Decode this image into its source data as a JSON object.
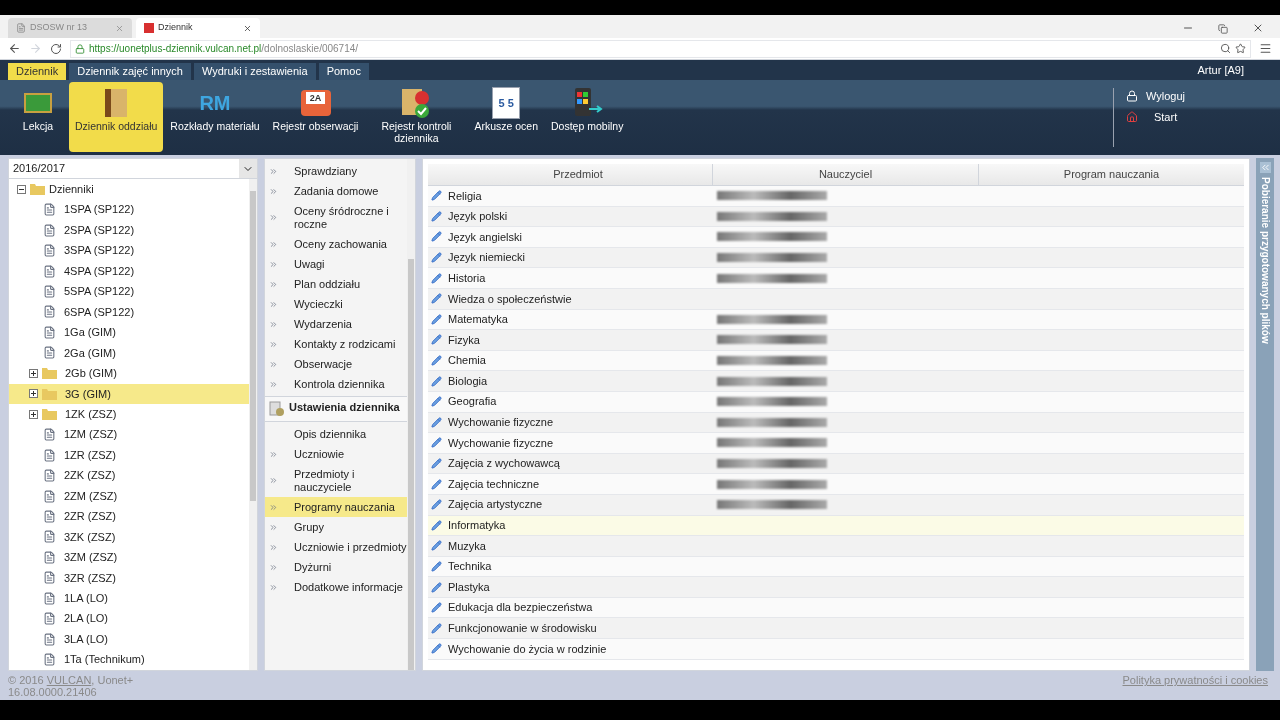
{
  "browser": {
    "tabs": [
      {
        "title": "DSOSW nr 13",
        "selected": false
      },
      {
        "title": "Dziennik",
        "selected": true
      }
    ],
    "url_host": "https://uonetplus-dziennik.vulcan.net.pl",
    "url_path": "/dolnoslaskie/006714/"
  },
  "menu_tabs": [
    {
      "label": "Dziennik",
      "selected": true
    },
    {
      "label": "Dziennik zajęć innych",
      "selected": false
    },
    {
      "label": "Wydruki i zestawienia",
      "selected": false
    },
    {
      "label": "Pomoc",
      "selected": false
    }
  ],
  "user": "Artur [A9]",
  "ribbon": [
    {
      "kind": "lesson",
      "label": "Lekcja",
      "selected": false
    },
    {
      "kind": "journal",
      "label": "Dziennik oddziału",
      "selected": true
    },
    {
      "kind": "rm",
      "icon_text": "RM",
      "label": "Rozkłady materiału",
      "selected": false
    },
    {
      "kind": "register",
      "icon_text": "2A",
      "label": "Rejestr obserwacji",
      "selected": false
    },
    {
      "kind": "check",
      "label": "Rejestr kontroli dziennika",
      "selected": false
    },
    {
      "kind": "sheets",
      "icon_text": "5 5",
      "label": "Arkusze ocen",
      "selected": false
    },
    {
      "kind": "mobile",
      "label": "Dostęp mobilny",
      "selected": false
    }
  ],
  "session_links": [
    {
      "kind": "logout",
      "label": "Wyloguj"
    },
    {
      "kind": "home",
      "label": "Start"
    }
  ],
  "year_select": "2016/2017",
  "tree": {
    "label": "Dzienniki",
    "expanded": true,
    "children": [
      {
        "kind": "file",
        "label": "1SPA (SP122)",
        "selected": false
      },
      {
        "kind": "file",
        "label": "2SPA (SP122)",
        "selected": false
      },
      {
        "kind": "file",
        "label": "3SPA (SP122)",
        "selected": false
      },
      {
        "kind": "file",
        "label": "4SPA (SP122)",
        "selected": false
      },
      {
        "kind": "file",
        "label": "5SPA (SP122)",
        "selected": false
      },
      {
        "kind": "file",
        "label": "6SPA (SP122)",
        "selected": false
      },
      {
        "kind": "file",
        "label": "1Ga (GIM)",
        "selected": false
      },
      {
        "kind": "file",
        "label": "2Ga (GIM)",
        "selected": false
      },
      {
        "kind": "folder",
        "label": "2Gb (GIM)",
        "selected": false
      },
      {
        "kind": "folder",
        "label": "3G (GIM)",
        "selected": true
      },
      {
        "kind": "folder",
        "label": "1ZK (ZSZ)",
        "selected": false
      },
      {
        "kind": "file",
        "label": "1ZM (ZSZ)",
        "selected": false
      },
      {
        "kind": "file",
        "label": "1ZR (ZSZ)",
        "selected": false
      },
      {
        "kind": "file",
        "label": "2ZK (ZSZ)",
        "selected": false
      },
      {
        "kind": "file",
        "label": "2ZM (ZSZ)",
        "selected": false
      },
      {
        "kind": "file",
        "label": "2ZR (ZSZ)",
        "selected": false
      },
      {
        "kind": "file",
        "label": "3ZK (ZSZ)",
        "selected": false
      },
      {
        "kind": "file",
        "label": "3ZM (ZSZ)",
        "selected": false
      },
      {
        "kind": "file",
        "label": "3ZR (ZSZ)",
        "selected": false
      },
      {
        "kind": "file",
        "label": "1LA (LO)",
        "selected": false
      },
      {
        "kind": "file",
        "label": "2LA (LO)",
        "selected": false
      },
      {
        "kind": "file",
        "label": "3LA (LO)",
        "selected": false
      },
      {
        "kind": "file",
        "label": "1Ta (Technikum)",
        "selected": false
      }
    ]
  },
  "menu": [
    {
      "kind": "link",
      "label": "Sprawdziany",
      "selected": false
    },
    {
      "kind": "link",
      "label": "Zadania domowe",
      "selected": false
    },
    {
      "kind": "link",
      "label": "Oceny śródroczne i roczne",
      "selected": false
    },
    {
      "kind": "link",
      "label": "Oceny zachowania",
      "selected": false
    },
    {
      "kind": "link",
      "label": "Uwagi",
      "selected": false
    },
    {
      "kind": "link",
      "label": "Plan oddziału",
      "selected": false
    },
    {
      "kind": "link",
      "label": "Wycieczki",
      "selected": false
    },
    {
      "kind": "link",
      "label": "Wydarzenia",
      "selected": false
    },
    {
      "kind": "link",
      "label": "Kontakty z rodzicami",
      "selected": false
    },
    {
      "kind": "link",
      "label": "Obserwacje",
      "selected": false
    },
    {
      "kind": "link",
      "label": "Kontrola dziennika",
      "selected": false
    },
    {
      "kind": "section",
      "label": "Ustawienia dziennika"
    },
    {
      "kind": "plain",
      "label": "Opis dziennika",
      "selected": false
    },
    {
      "kind": "link",
      "label": "Uczniowie",
      "selected": false
    },
    {
      "kind": "link",
      "label": "Przedmioty i nauczyciele",
      "selected": false
    },
    {
      "kind": "link",
      "label": "Programy nauczania",
      "selected": true
    },
    {
      "kind": "link",
      "label": "Grupy",
      "selected": false
    },
    {
      "kind": "link",
      "label": "Uczniowie i przedmioty",
      "selected": false
    },
    {
      "kind": "link",
      "label": "Dyżurni",
      "selected": false
    },
    {
      "kind": "link",
      "label": "Dodatkowe informacje",
      "selected": false
    }
  ],
  "table": {
    "columns": [
      "Przedmiot",
      "Nauczyciel",
      "Program nauczania"
    ],
    "rows": [
      {
        "subject": "Religia",
        "teacher_redacted": true,
        "highlighted": false
      },
      {
        "subject": "Język polski",
        "teacher_redacted": true,
        "highlighted": false
      },
      {
        "subject": "Język angielski",
        "teacher_redacted": true,
        "highlighted": false
      },
      {
        "subject": "Język niemiecki",
        "teacher_redacted": true,
        "highlighted": false
      },
      {
        "subject": "Historia",
        "teacher_redacted": true,
        "highlighted": false
      },
      {
        "subject": "Wiedza o społeczeństwie",
        "teacher_redacted": false,
        "highlighted": false
      },
      {
        "subject": "Matematyka",
        "teacher_redacted": true,
        "highlighted": false
      },
      {
        "subject": "Fizyka",
        "teacher_redacted": true,
        "highlighted": false
      },
      {
        "subject": "Chemia",
        "teacher_redacted": true,
        "highlighted": false
      },
      {
        "subject": "Biologia",
        "teacher_redacted": true,
        "highlighted": false
      },
      {
        "subject": "Geografia",
        "teacher_redacted": true,
        "highlighted": false
      },
      {
        "subject": "Wychowanie fizyczne",
        "teacher_redacted": true,
        "highlighted": false
      },
      {
        "subject": "Wychowanie fizyczne",
        "teacher_redacted": true,
        "highlighted": false
      },
      {
        "subject": "Zajęcia z wychowawcą",
        "teacher_redacted": true,
        "highlighted": false
      },
      {
        "subject": "Zajęcia techniczne",
        "teacher_redacted": true,
        "highlighted": false
      },
      {
        "subject": "Zajęcia artystyczne",
        "teacher_redacted": true,
        "highlighted": false
      },
      {
        "subject": "Informatyka",
        "teacher_redacted": false,
        "highlighted": true
      },
      {
        "subject": "Muzyka",
        "teacher_redacted": false,
        "highlighted": false
      },
      {
        "subject": "Technika",
        "teacher_redacted": false,
        "highlighted": false
      },
      {
        "subject": "Plastyka",
        "teacher_redacted": false,
        "highlighted": false
      },
      {
        "subject": "Edukacja dla bezpieczeństwa",
        "teacher_redacted": false,
        "highlighted": false
      },
      {
        "subject": "Funkcjonowanie w środowisku",
        "teacher_redacted": false,
        "highlighted": false
      },
      {
        "subject": "Wychowanie do życia w rodzinie",
        "teacher_redacted": false,
        "highlighted": false
      }
    ]
  },
  "side_panel": "Pobieranie przygotowanych plików",
  "footer": {
    "copyright": "© 2016",
    "company": "VULCAN",
    "product": ", Uonet+",
    "version": "16.08.0000.21406",
    "privacy": "Polityka prywatności i cookies"
  }
}
